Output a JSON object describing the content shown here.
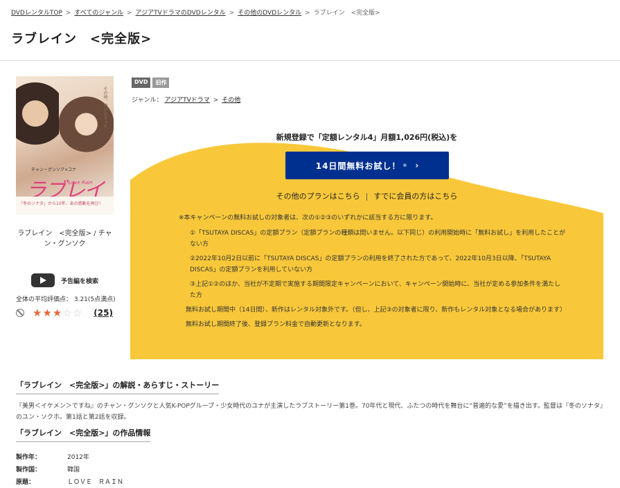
{
  "breadcrumb": [
    {
      "label": "DVDレンタルTOP",
      "link": true
    },
    {
      "label": "すべてのジャンル",
      "link": true
    },
    {
      "label": "アジアTVドラマのDVDレンタル",
      "link": true
    },
    {
      "label": "その他のDVDレンタル",
      "link": true
    },
    {
      "label": "ラブレイン　<完全版>",
      "link": false
    }
  ],
  "breadcrumb_separator": ">",
  "title": "ラブレイン　<完全版>",
  "cover": {
    "cast_text": "チャン・グンソク×ユナ",
    "logo_text": "ラブレイン",
    "logo_sub": "Love Rain",
    "band_text": "「冬のソナタ」から10年、あの感動を再び！",
    "tag_text": "その時、時が止まった"
  },
  "caption": "ラブレイン　<完全版> / チャン・グンソク",
  "trailer_label": "予告編を検索",
  "rating": {
    "label": "全体の平均評価点：  3.21(5点満点)",
    "value": 3.21,
    "max": 5,
    "review_count": "(25)",
    "stars_filled": 3
  },
  "badges": [
    "DVD",
    "旧作"
  ],
  "genre": {
    "label": "ジャンル：",
    "links": [
      "アジアTVドラマ",
      "その他"
    ],
    "separator": ">"
  },
  "promo": {
    "headline": "新規登録で「定額レンタル4」月額1,026円(税込)を",
    "button_label": "14日間無料お試し！",
    "button_note": "※",
    "button_arrow": "›",
    "link_other_plans": "その他のプランはこちら",
    "link_separator": "|",
    "link_members": "すでに会員の方はこちら",
    "notes": {
      "intro": "※本キャンペーンの無料お試しの対象者は、次の①②③のいずれかに該当する方に限ります。",
      "item1": "①「TSUTAYA DISCAS」の定額プラン（定額プランの種類は問いません。以下同じ）の利用開始時に「無料お試し」を利用したことがない方",
      "item2": "②2022年10月2日以前に「TSUTAYA DISCAS」の定額プランの利用を終了された方であって、2022年10月3日以降、「TSUTAYA DISCAS」の定額プランを利用していない方",
      "item3": "③上記①②のほか、当社が不定期で実施する期間限定キャンペーンにおいて、キャンペーン開始時に、当社が定める参加条件を満たした方",
      "extra1": "無料お試し期間中（14日間）、新作はレンタル対象外です。（但し、上記③の対象者に限り、新作もレンタル対象となる場合があります）",
      "extra2": "無料お試し期間終了後、登録プラン料金で自動更新となります。"
    },
    "bg_color": "#f8c83a",
    "button_color": "#00308f"
  },
  "section_story": {
    "heading": "「ラブレイン　<完全版>」の解説・あらすじ・ストーリー",
    "text": "『美男＜イケメン＞ですね』のチャン・グンソクと人気K-POPグループ・少女時代のユナが主演したラブストーリー第1巻。70年代と現代、ふたつの時代を舞台に“普遍的な愛”を描き出す。監督は『冬のソナタ』のユン・ソクホ。第1話と第2話を収録。"
  },
  "section_info": {
    "heading": "「ラブレイン　<完全版>」の作品情報",
    "rows": [
      {
        "key": "製作年：",
        "value": "2012年"
      },
      {
        "key": "製作国：",
        "value": "韓国"
      },
      {
        "key": "原題：",
        "value": "ＬＯＶＥ　ＲＡＩＮ"
      }
    ]
  }
}
